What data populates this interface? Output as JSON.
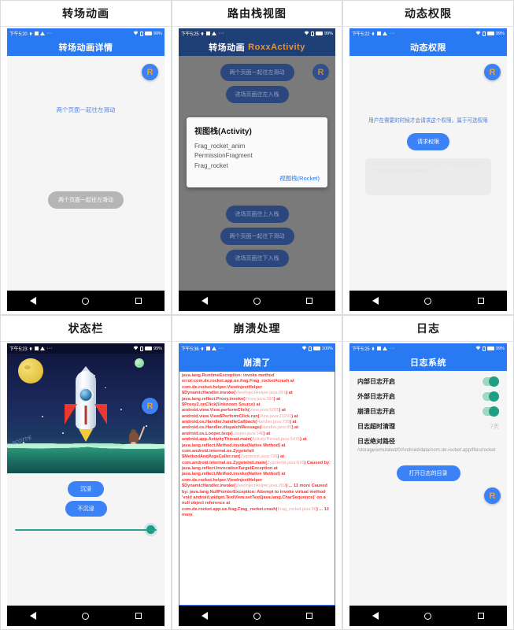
{
  "cells": [
    {
      "title": "转场动画",
      "status": {
        "time": "下午5:20",
        "battery": "99%"
      },
      "appbar": "转场动画详情",
      "fab": "R",
      "hint": "两个页面一起往左滑动",
      "button": "两个页面一起往左滑动"
    },
    {
      "title": "路由栈视图",
      "status": {
        "time": "下午5:25",
        "battery": "99%"
      },
      "appbar": "转场动画",
      "appbar_sub": "RoxxActivity",
      "fab": "R",
      "buttons_top": [
        "两个页面一起往左滑动",
        "进场页面往左入栈"
      ],
      "buttons_bottom": [
        "进场页面往上入栈",
        "两个页面一起往下滑动",
        "进场页面往下入栈"
      ],
      "dialog": {
        "title": "视图栈(Activity)",
        "items": [
          "Frag_rocket_anim",
          "PermissionFragment",
          "Frag_rocket"
        ],
        "action": "视图栈(Rocket)"
      }
    },
    {
      "title": "动态权限",
      "status": {
        "time": "下午5:22",
        "battery": "99%"
      },
      "appbar": "动态权限",
      "fab": "R",
      "desc": "用户在需要的时候才会请求这个权限，属于可选权限",
      "button": "请求权限",
      "toast": "此应用需要访问您的设备权限以便正常工作，请在系统设置中授予相应权限后重试该操作谢谢配合"
    },
    {
      "title": "状态栏",
      "status": {
        "time": "下午5:23",
        "battery": "99%"
      },
      "fab": "R",
      "art_caption": "SCOTTIE",
      "buttons": [
        "沉浸",
        "不沉浸"
      ],
      "slider_value": 100
    },
    {
      "title": "崩溃处理",
      "status": {
        "time": "下午5:36",
        "battery": "100%"
      },
      "appbar": "崩溃了",
      "stacktrace_segments": [
        {
          "t": "java.lang.RuntimeException: invoke method error:com.de.rocket.app.ue.frag.Frag_rocket#crash at com.de.rocket.helper.ViewInjectHelper $DynamicHandler.invoke(",
          "d": false
        },
        {
          "t": "ViewInjectHelper.java:261",
          "d": true
        },
        {
          "t": ") at java.lang.reflect.Proxy.invoke(",
          "d": false
        },
        {
          "t": "Proxy.java:393",
          "d": true
        },
        {
          "t": ") at $Proxy2.onClick(Unknown Source) at android.view.View.performClick(",
          "d": false
        },
        {
          "t": "View.java:5265",
          "d": true
        },
        {
          "t": ") at android.view.View$PerformClick.run(",
          "d": false
        },
        {
          "t": "View.java:21291",
          "d": true
        },
        {
          "t": ") at android.os.Handler.handleCallback(",
          "d": false
        },
        {
          "t": "Handler.java:739",
          "d": true
        },
        {
          "t": ") at android.os.Handler.dispatchMessage(",
          "d": false
        },
        {
          "t": "Handler.java:95",
          "d": true
        },
        {
          "t": ") at android.os.Looper.loop(",
          "d": false
        },
        {
          "t": "Looper.java:148",
          "d": true
        },
        {
          "t": ") at android.app.ActivityThread.main(",
          "d": false
        },
        {
          "t": "ActivityThread.java:5475",
          "d": true
        },
        {
          "t": ") at java.lang.reflect.Method.invoke(Native Method) at com.android.internal.os.ZygoteInit $MethodAndArgsCaller.run(",
          "d": false
        },
        {
          "t": "ZygoteInit.java:726",
          "d": true
        },
        {
          "t": ") at com.android.internal.os.ZygoteInit.main(",
          "d": false
        },
        {
          "t": "ZygoteInit.java:616",
          "d": true
        },
        {
          "t": ") Caused by: java.lang.reflect.InvocationTargetException at java.lang.reflect.Method.invoke(Native Method) at com.de.rocket.helper.ViewInjectHelper $DynamicHandler.invoke(",
          "d": false
        },
        {
          "t": "ViewInjectHelper.java:259",
          "d": true
        },
        {
          "t": ") ... 11 more Caused by: java.lang.NullPointerException: Attempt to invoke virtual method 'void android.widget.TextView.setText(java.lang.CharSequence)' on a null object reference at com.de.rocket.app.ue.frag.Frag_rocket.crash(",
          "d": false
        },
        {
          "t": "Frag_rocket.java:90",
          "d": true
        },
        {
          "t": ") ... 13 more",
          "d": false
        }
      ]
    },
    {
      "title": "日志",
      "status": {
        "time": "下午5:25",
        "battery": "99%"
      },
      "appbar": "日志系统",
      "fab": "R",
      "rows": [
        {
          "label": "内部日志开启",
          "type": "switch",
          "on": true
        },
        {
          "label": "外部日志开启",
          "type": "switch",
          "on": true
        },
        {
          "label": "崩溃日志开启",
          "type": "switch",
          "on": true
        },
        {
          "label": "日志超时清理",
          "type": "value",
          "value": "7天"
        },
        {
          "label": "日志绝对路径",
          "type": "header"
        }
      ],
      "path": "/storage/emulated/0/Android/data/com.de.rocket.app/files/rocket",
      "button": "打开日志的目录"
    }
  ],
  "colors": {
    "primary": "#2979f2",
    "dim_primary": "#1f3f77",
    "accent_orange": "#e8943a",
    "crash_red": "#ff2f2f",
    "switch_on": "#1f9e86"
  }
}
